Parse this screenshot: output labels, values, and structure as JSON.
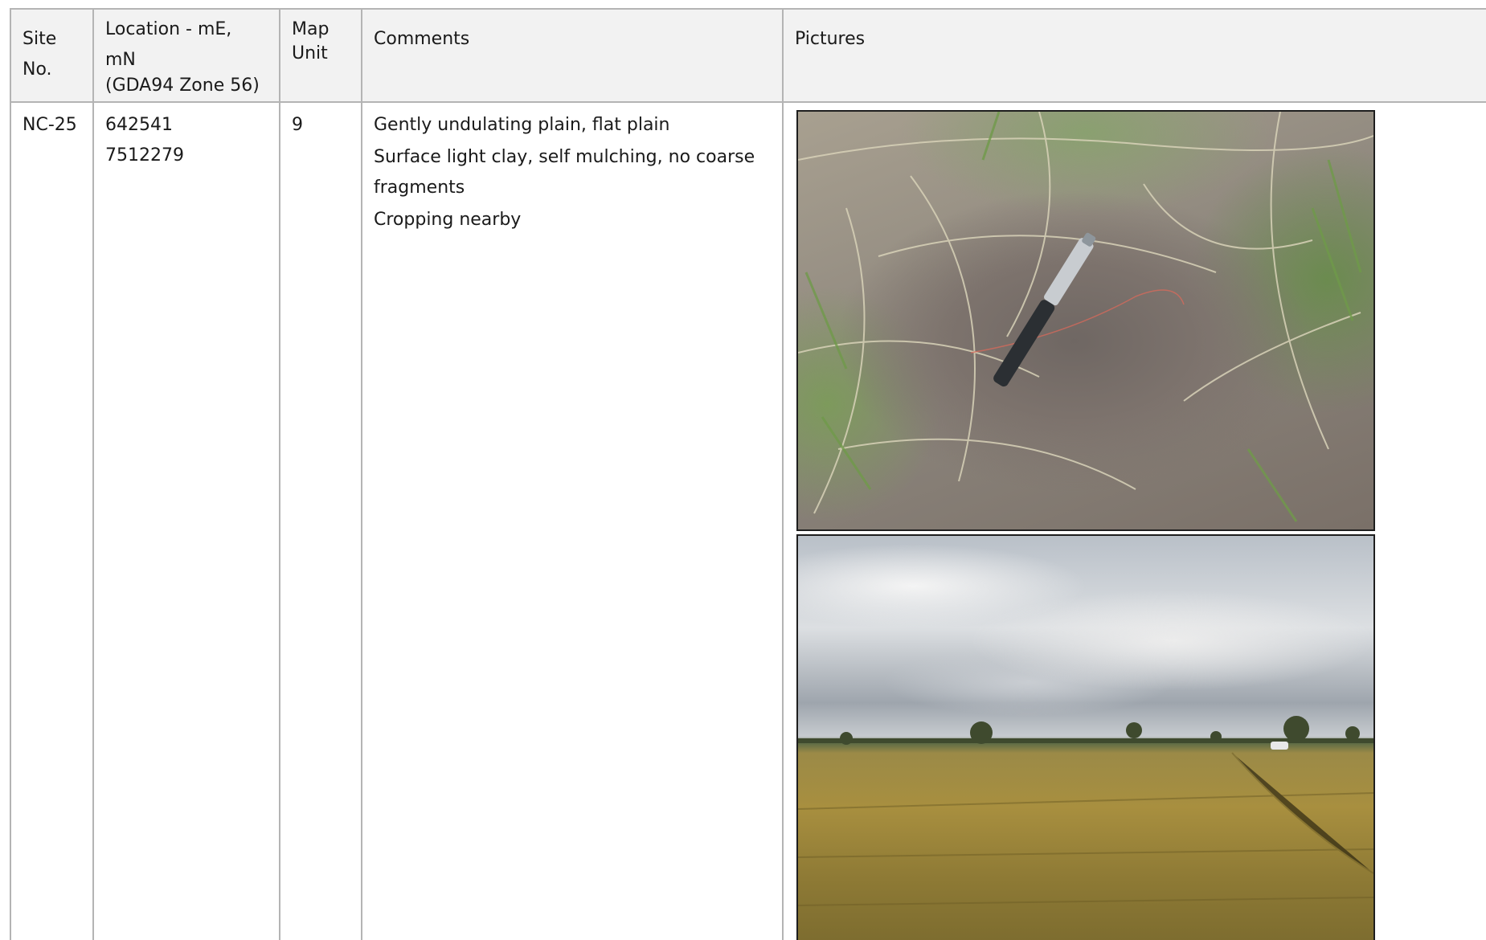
{
  "table": {
    "headers": {
      "site_no": "Site No.",
      "location_line1": "Location - mE, mN",
      "location_line2": "(GDA94 Zone 56)",
      "map_unit_line1": "Map",
      "map_unit_line2": "Unit",
      "comments": "Comments",
      "pictures": "Pictures"
    },
    "rows": [
      {
        "site_no": "NC-25",
        "easting": "642541",
        "northing": "7512279",
        "map_unit": "9",
        "comments": [
          "Gently undulating plain, flat plain",
          "Surface light clay, self mulching, no coarse fragments",
          "Cropping nearby"
        ]
      }
    ]
  }
}
